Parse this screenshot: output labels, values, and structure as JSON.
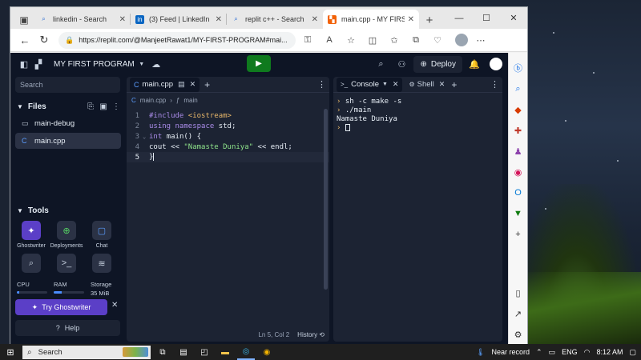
{
  "browser": {
    "tabs": [
      {
        "title": "linkedin - Search",
        "icon": "search-icon"
      },
      {
        "title": "(3) Feed | LinkedIn",
        "icon": "linkedin-icon"
      },
      {
        "title": "replit c++ - Search",
        "icon": "search-icon"
      },
      {
        "title": "main.cpp - MY FIRST PROGR",
        "icon": "replit-icon"
      }
    ],
    "url": "https://replit.com/@ManjeetRawat1/MY-FIRST-PROGRAM#mai..."
  },
  "replit": {
    "project_name": "MY FIRST PROGRAM",
    "deploy_label": "Deploy",
    "search_placeholder": "Search",
    "files_header": "Files",
    "files": [
      "main-debug",
      "main.cpp"
    ],
    "tools_header": "Tools",
    "tools": [
      "Ghostwriter",
      "Deployments",
      "Chat"
    ],
    "stats": [
      {
        "label": "CPU",
        "fill": 0.08,
        "value": ""
      },
      {
        "label": "RAM",
        "fill": 0.25,
        "value": ""
      },
      {
        "label": "Storage",
        "fill": 0,
        "value": "35 MiB"
      }
    ],
    "try_ghostwriter": "Try Ghostwriter",
    "help": "Help",
    "editor": {
      "tab": "main.cpp",
      "breadcrumb_file": "main.cpp",
      "breadcrumb_symbol": "main",
      "status": "Ln 5, Col 2",
      "history": "History"
    },
    "console": {
      "tab": "Console",
      "shell_tab": "Shell",
      "lines": [
        "sh -c make -s",
        "./main",
        "Namaste Duniya"
      ]
    }
  },
  "code": {
    "line_numbers": [
      "1",
      "2",
      "3",
      "4",
      "5"
    ],
    "l1_a": "#include ",
    "l1_b": "<iostream>",
    "l2_a": "using",
    "l2_b": "namespace",
    "l2_c": " std;",
    "l3_a": "int",
    "l3_b": " main() {",
    "l4_a": "cout << ",
    "l4_b": "\"Namaste Duniya\"",
    "l4_c": " << endl;",
    "l5_a": "}"
  },
  "taskbar": {
    "search": "Search",
    "weather": "Near record",
    "lang": "ENG",
    "time": "8:12 AM"
  },
  "colors": {
    "accent": "#5b3fc7",
    "run": "#0f7a1e",
    "bg": "#0e1525"
  }
}
